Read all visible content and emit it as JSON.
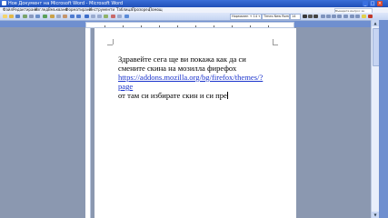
{
  "window": {
    "title": "Нов Документ на Microsoft Word - Microsoft Word",
    "minimize_glyph": "_",
    "maximize_glyph": "□",
    "close_glyph": "×"
  },
  "menu": [
    "Файл",
    "Редактиране",
    "Изглед",
    "Вмъкване",
    "Форматиране",
    "Инструменти",
    "Таблица",
    "Прозорец",
    "Помощ"
  ],
  "help_box": {
    "placeholder": "Въведете въпрос за помощ"
  },
  "toolbar": {
    "style": "Нормален + 14 т",
    "font": "Times New Roman",
    "size": "14"
  },
  "document": {
    "lines": [
      "Здравейте сега ще ви покажа как да си",
      "смените скина на мозилла фирефох",
      "https://addons.mozilla.org/bg/firefox/themes/?",
      "page",
      " от там си избирате скин и си пре"
    ]
  },
  "scrollbar": {
    "up": "▲",
    "down": "▼"
  },
  "colors": {
    "title_bar": "#2a5fc9",
    "link": "#1a33cc",
    "close_button": "#d9472b"
  }
}
